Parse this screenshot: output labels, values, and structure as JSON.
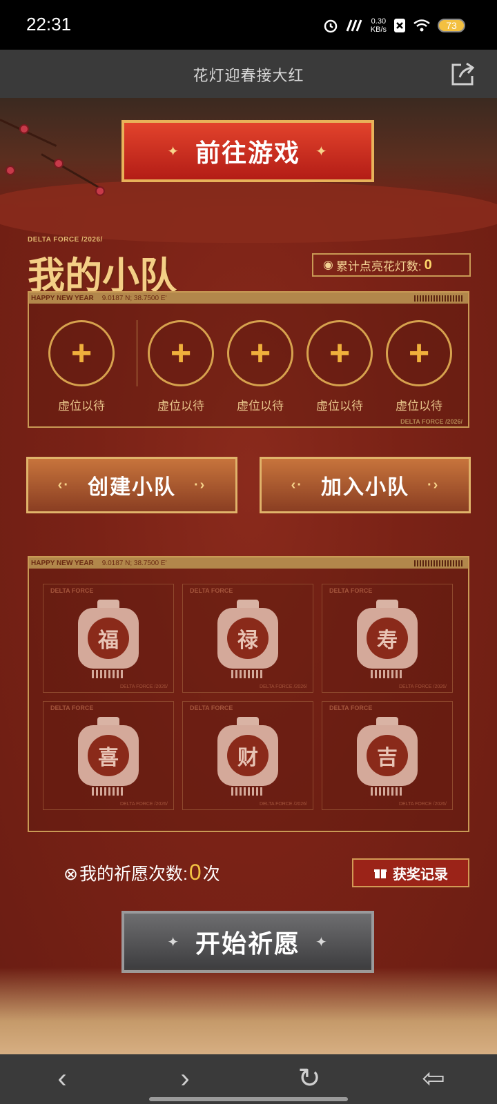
{
  "status_bar": {
    "time": "22:31",
    "net_speed_value": "0.30",
    "net_speed_unit": "KB/s",
    "battery": "73"
  },
  "title_bar": {
    "title": "花灯迎春接大红",
    "share_icon": "share-icon"
  },
  "hero": {
    "go_game_label": "前往游戏"
  },
  "team": {
    "subtitle": "DELTA FORCE /2026/",
    "title": "我的小队",
    "lantern_count_label": "累计点亮花灯数:",
    "lantern_count_value": "0",
    "panel_header": "HAPPY NEW YEAR",
    "panel_coords": "9.0187  N; 38.7500  E'",
    "panel_footer": "DELTA FORCE /2026/",
    "slots": [
      {
        "icon": "+",
        "label": "虚位以待"
      },
      {
        "icon": "+",
        "label": "虚位以待"
      },
      {
        "icon": "+",
        "label": "虚位以待"
      },
      {
        "icon": "+",
        "label": "虚位以待"
      },
      {
        "icon": "+",
        "label": "虚位以待"
      }
    ]
  },
  "actions": {
    "create_team": "创建小队",
    "join_team": "加入小队"
  },
  "lanterns": {
    "panel_header": "HAPPY NEW YEAR",
    "panel_coords": "9.0187  N; 38.7500  E'",
    "cell_tag": "DELTA FORCE",
    "cell_footer": "DELTA FORCE /2026/",
    "items": [
      {
        "char": "福"
      },
      {
        "char": "禄"
      },
      {
        "char": "寿"
      },
      {
        "char": "喜"
      },
      {
        "char": "财"
      },
      {
        "char": "吉"
      }
    ]
  },
  "wish": {
    "label": "我的祈愿次数:",
    "count": "0",
    "unit": "次",
    "record_label": "获奖记录",
    "start_label": "开始祈愿"
  },
  "nav": {
    "back": "‹",
    "forward": "›",
    "refresh": "↻",
    "exit": "⇦"
  },
  "colors": {
    "primary_red": "#b31d16",
    "gold": "#e8b25a",
    "bg": "#7a2216"
  }
}
